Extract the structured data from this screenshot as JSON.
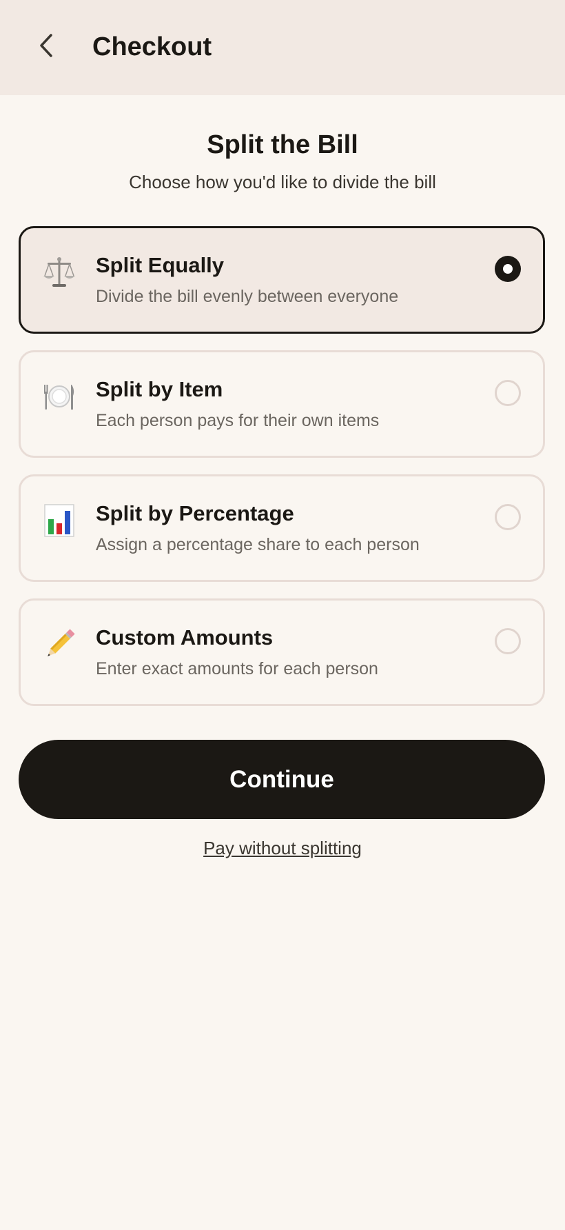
{
  "header": {
    "title": "Checkout",
    "back_icon": "chevron-left-icon"
  },
  "main": {
    "title": "Split the Bill",
    "subtitle": "Choose how you'd like to divide the bill"
  },
  "options": [
    {
      "icon": "scales-icon",
      "title": "Split Equally",
      "description": "Divide the bill evenly between everyone",
      "selected": true
    },
    {
      "icon": "plate-cutlery-icon",
      "title": "Split by Item",
      "description": "Each person pays for their own items",
      "selected": false
    },
    {
      "icon": "bar-chart-icon",
      "title": "Split by Percentage",
      "description": "Assign a percentage share to each person",
      "selected": false
    },
    {
      "icon": "pencil-icon",
      "title": "Custom Amounts",
      "description": "Enter exact amounts for each person",
      "selected": false
    }
  ],
  "actions": {
    "continue_label": "Continue",
    "pay_without_split_label": "Pay without splitting"
  },
  "colors": {
    "background": "#faf6f1",
    "header_bg": "#f2e9e3",
    "accent_dark": "#1b1814",
    "border": "#e8dcd6",
    "muted_text": "#6b6660"
  }
}
